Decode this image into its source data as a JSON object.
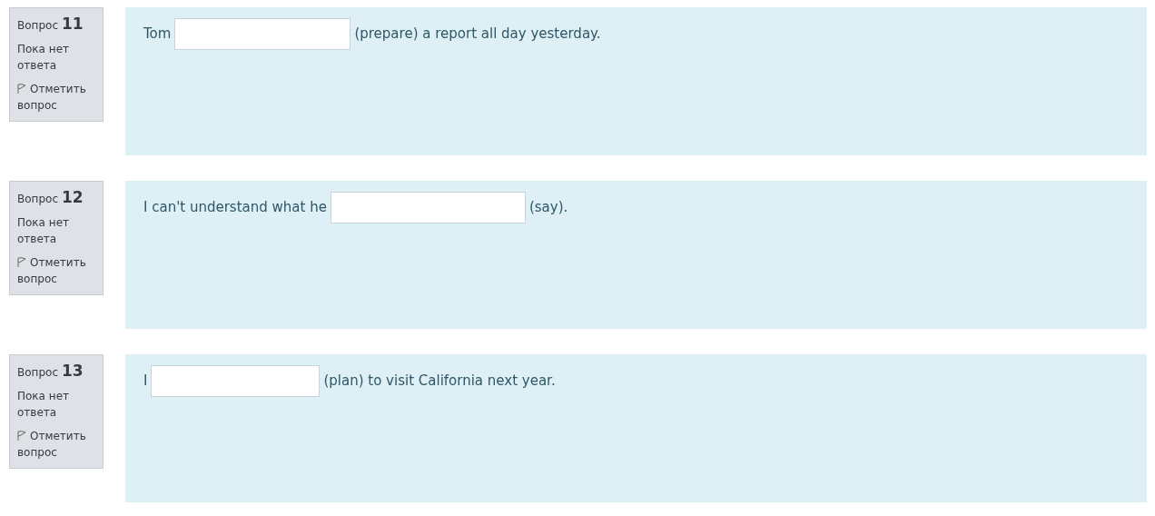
{
  "questions": [
    {
      "label": "Вопрос",
      "number": "11",
      "status": "Пока нет ответа",
      "flag": "Отметить вопрос",
      "before": "Tom",
      "after": "(prepare) a report all day yesterday."
    },
    {
      "label": "Вопрос",
      "number": "12",
      "status": "Пока нет ответа",
      "flag": "Отметить вопрос",
      "before": "I can't understand what he",
      "after": "(say)."
    },
    {
      "label": "Вопрос",
      "number": "13",
      "status": "Пока нет ответа",
      "flag": "Отметить вопрос",
      "before": "I",
      "after": "(plan) to visit California next year."
    }
  ]
}
